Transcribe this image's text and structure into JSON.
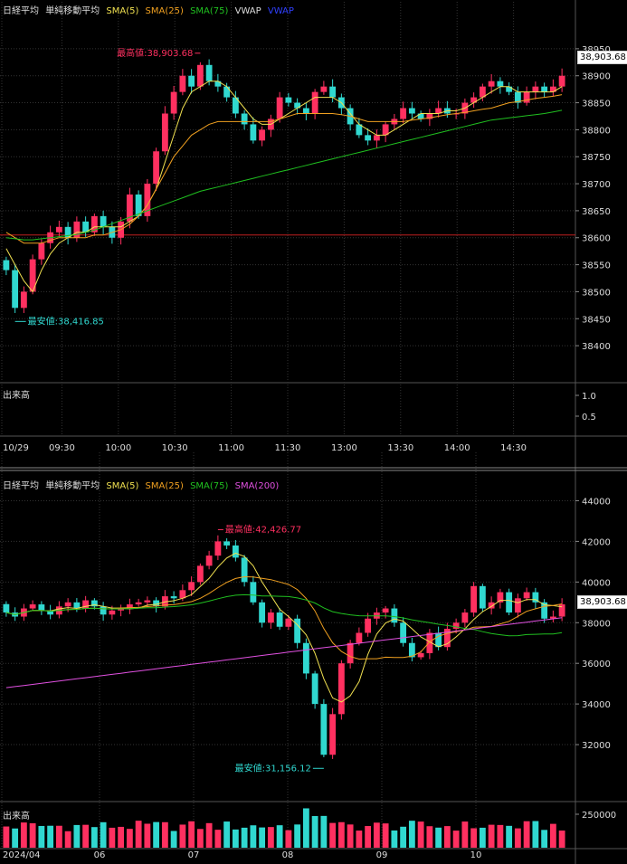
{
  "chart_data": [
    {
      "type": "candlestick",
      "title": "日経平均",
      "panel": "intraday",
      "legend": {
        "items": [
          {
            "label": "日経平均",
            "color": "#dddddd"
          },
          {
            "label": "単純移動平均",
            "color": "#dddddd"
          },
          {
            "label": "SMA(5)",
            "color": "#f0e050"
          },
          {
            "label": "SMA(25)",
            "color": "#f0a020"
          },
          {
            "label": "SMA(75)",
            "color": "#20c020"
          },
          {
            "label": "VWAP",
            "color": "#dddddd"
          },
          {
            "label": "VWAP",
            "color": "#3040ff"
          }
        ]
      },
      "ylim": [
        38370,
        38985
      ],
      "y_ticks": [
        "38950",
        "38900",
        "38850",
        "38800",
        "38750",
        "38700",
        "38650",
        "38600",
        "38550",
        "38500",
        "38450",
        "38400"
      ],
      "x_ticks": [
        "10/29",
        "09:30",
        "10:00",
        "10:30",
        "11:00",
        "11:30",
        "13:00",
        "13:30",
        "14:00",
        "14:30"
      ],
      "reference_line": 38605,
      "last_price": "38,903.68",
      "high_label": "最高値:38,903.68",
      "low_label": "最安値:38,416.85",
      "close": [
        38540,
        38470,
        38500,
        38560,
        38590,
        38610,
        38620,
        38600,
        38630,
        38610,
        38640,
        38620,
        38600,
        38630,
        38680,
        38640,
        38700,
        38760,
        38830,
        38870,
        38900,
        38880,
        38920,
        38890,
        38880,
        38860,
        38830,
        38810,
        38780,
        38800,
        38820,
        38860,
        38850,
        38840,
        38830,
        38870,
        38880,
        38860,
        38840,
        38810,
        38790,
        38780,
        38790,
        38810,
        38820,
        38840,
        38830,
        38820,
        38830,
        38840,
        38830,
        38830,
        38850,
        38860,
        38880,
        38890,
        38880,
        38870,
        38850,
        38870,
        38880,
        38870,
        38880,
        38900
      ],
      "sma5": [
        38580,
        38550,
        38520,
        38500,
        38540,
        38570,
        38590,
        38600,
        38610,
        38610,
        38620,
        38620,
        38620,
        38620,
        38630,
        38640,
        38660,
        38690,
        38740,
        38790,
        38840,
        38870,
        38880,
        38890,
        38890,
        38880,
        38860,
        38840,
        38820,
        38810,
        38810,
        38820,
        38830,
        38840,
        38850,
        38860,
        38860,
        38860,
        38850,
        38830,
        38810,
        38800,
        38790,
        38790,
        38800,
        38810,
        38820,
        38830,
        38830,
        38830,
        38835,
        38835,
        38840,
        38850,
        38860,
        38870,
        38880,
        38880,
        38870,
        38870,
        38870,
        38870,
        38870,
        38880
      ],
      "sma25": [
        38610,
        38600,
        38590,
        38590,
        38590,
        38595,
        38600,
        38600,
        38600,
        38600,
        38605,
        38605,
        38610,
        38615,
        38625,
        38640,
        38660,
        38690,
        38720,
        38750,
        38770,
        38790,
        38800,
        38810,
        38815,
        38815,
        38815,
        38815,
        38815,
        38815,
        38815,
        38820,
        38825,
        38830,
        38830,
        38830,
        38830,
        38830,
        38828,
        38825,
        38820,
        38815,
        38815,
        38815,
        38815,
        38815,
        38818,
        38820,
        38822,
        38825,
        38828,
        38830,
        38832,
        38835,
        38838,
        38840,
        38845,
        38850,
        38852,
        38855,
        38858,
        38860,
        38862,
        38865
      ],
      "sma75": [
        38600,
        38598,
        38596,
        38596,
        38598,
        38600,
        38602,
        38604,
        38606,
        38610,
        38614,
        38620,
        38626,
        38632,
        38638,
        38644,
        38650,
        38656,
        38662,
        38668,
        38674,
        38680,
        38686,
        38690,
        38694,
        38698,
        38702,
        38706,
        38710,
        38714,
        38718,
        38722,
        38726,
        38730,
        38734,
        38738,
        38742,
        38746,
        38750,
        38754,
        38758,
        38762,
        38766,
        38770,
        38774,
        38778,
        38782,
        38786,
        38790,
        38794,
        38798,
        38802,
        38806,
        38810,
        38814,
        38818,
        38820,
        38822,
        38824,
        38826,
        38828,
        38830,
        38833,
        38836
      ],
      "volume_panel": {
        "label": "出来高",
        "ticks": [
          "1.0",
          "0.5"
        ]
      }
    },
    {
      "type": "candlestick",
      "title": "日経平均",
      "panel": "daily",
      "legend": {
        "items": [
          {
            "label": "日経平均",
            "color": "#dddddd"
          },
          {
            "label": "単純移動平均",
            "color": "#dddddd"
          },
          {
            "label": "SMA(5)",
            "color": "#f0e050"
          },
          {
            "label": "SMA(25)",
            "color": "#f0a020"
          },
          {
            "label": "SMA(75)",
            "color": "#20c020"
          },
          {
            "label": "SMA(200)",
            "color": "#e050e0"
          }
        ]
      },
      "ylim": [
        30800,
        44600
      ],
      "y_ticks": [
        "44000",
        "42000",
        "40000",
        "38000",
        "36000",
        "34000",
        "32000"
      ],
      "x_ticks": [
        "2024/04",
        "06",
        "07",
        "08",
        "09",
        "10"
      ],
      "last_price": "38,903.68",
      "high_label": "最高値:42,426.77",
      "low_label": "最安値:31,156.12",
      "close": [
        38500,
        38300,
        38700,
        38900,
        38600,
        38400,
        38800,
        39000,
        38700,
        39100,
        38800,
        38400,
        38600,
        38700,
        38900,
        39000,
        39100,
        38800,
        39300,
        39200,
        39600,
        40000,
        40800,
        41300,
        42000,
        41800,
        41200,
        40000,
        39000,
        38000,
        38500,
        37800,
        38200,
        37000,
        35500,
        34000,
        31500,
        33500,
        36000,
        37000,
        37500,
        38200,
        38500,
        38700,
        38000,
        37000,
        36300,
        36500,
        37500,
        36800,
        37700,
        38000,
        38500,
        39800,
        38700,
        39000,
        39500,
        38500,
        39200,
        39500,
        39000,
        38200,
        38300,
        38903
      ]
    }
  ],
  "volume_panel_bottom": {
    "label": "出来高",
    "ticks": [
      "250000"
    ]
  }
}
